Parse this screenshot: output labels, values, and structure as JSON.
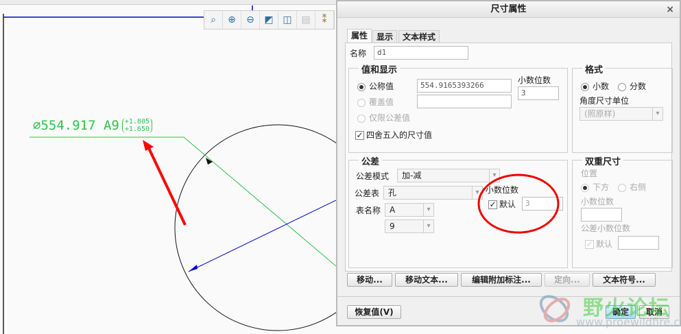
{
  "drawing": {
    "diameter_symbol": "∅",
    "dim_value": "554.917",
    "tol_class": "A9",
    "upper_tol": "+1.805",
    "lower_tol": "+1.650"
  },
  "toolbar": {
    "icons": [
      "refit-icon",
      "zoom-in-icon",
      "zoom-out-icon",
      "repaint-icon",
      "display-style-icon",
      "saved-views-icon",
      "datum-display-icon"
    ]
  },
  "dialog": {
    "title": "尺寸属性",
    "close": "×",
    "tabs": [
      "属性",
      "显示",
      "文本样式"
    ],
    "name_label": "名称",
    "name_value": "d1",
    "value_group": {
      "title": "值和显示",
      "nominal": "公称值",
      "nominal_value": "554.9165393266",
      "override": "覆盖值",
      "override_value": "",
      "tol_only": "仅限公差值",
      "decimals_label": "小数位数",
      "decimals_value": "3",
      "round_label": "四舍五入的尺寸值",
      "round_checked": true
    },
    "format_group": {
      "title": "格式",
      "decimal": "小数",
      "fraction": "分数",
      "angle_label": "角度尺寸单位",
      "angle_value": "(照原样)"
    },
    "tolerance_group": {
      "title": "公差",
      "mode_label": "公差模式",
      "mode_value": "加-减",
      "table_label": "公差表",
      "table_value": "孔",
      "table_name_label": "表名称",
      "table_name_value": "A",
      "grade_value": "9",
      "decimals_label": "小数位数",
      "default_label": "默认",
      "default_checked": true,
      "decimals_value": "3"
    },
    "dual_group": {
      "title": "双重尺寸",
      "position_label": "位置",
      "below": "下方",
      "right": "右侧",
      "decimals_label": "小数位数",
      "tol_decimals_label": "公差小数位数",
      "default_label": "默认"
    },
    "buttons": {
      "move": "移动...",
      "move_text": "移动文本...",
      "edit_note": "编辑附加标注...",
      "orient": "定向...",
      "text_symbol": "文本符号...",
      "restore": "恢复值(V)",
      "ok": "确定",
      "cancel": "取消"
    }
  },
  "watermark": {
    "text": "野火论坛",
    "url": "www.proewildfire.cn"
  },
  "colors": {
    "dimension": "#2ec24a",
    "annotation": "#ff0000",
    "blue_line": "#0000cc"
  }
}
